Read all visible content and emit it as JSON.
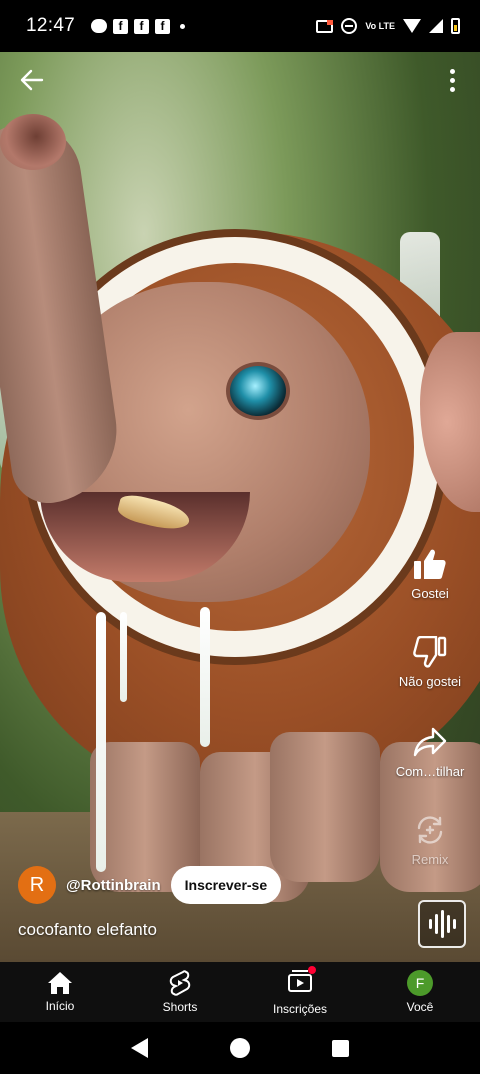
{
  "status_bar": {
    "time": "12:47",
    "notifications": [
      "chat-icon",
      "facebook-icon",
      "facebook-icon",
      "facebook-icon"
    ],
    "network_label": "Vo LTE",
    "battery_color": "#f5c518"
  },
  "video": {
    "description_icons": [
      "back-arrow-icon",
      "more-vert-icon"
    ]
  },
  "actions": {
    "like_label": "Gostei",
    "dislike_label": "Não gostei",
    "share_label": "Com…tilhar",
    "remix_label": "Remix"
  },
  "channel": {
    "avatar_letter": "R",
    "avatar_color": "#e36f13",
    "handle": "@Rottinbrain",
    "subscribe_label": "Inscrever-se"
  },
  "video_title": "cocofanto elefanto",
  "bottom_nav": {
    "items": [
      {
        "label": "Início"
      },
      {
        "label": "Shorts"
      },
      {
        "label": "Inscrições"
      },
      {
        "label": "Você"
      }
    ],
    "profile_letter": "F",
    "profile_color": "#4c9a2a"
  }
}
